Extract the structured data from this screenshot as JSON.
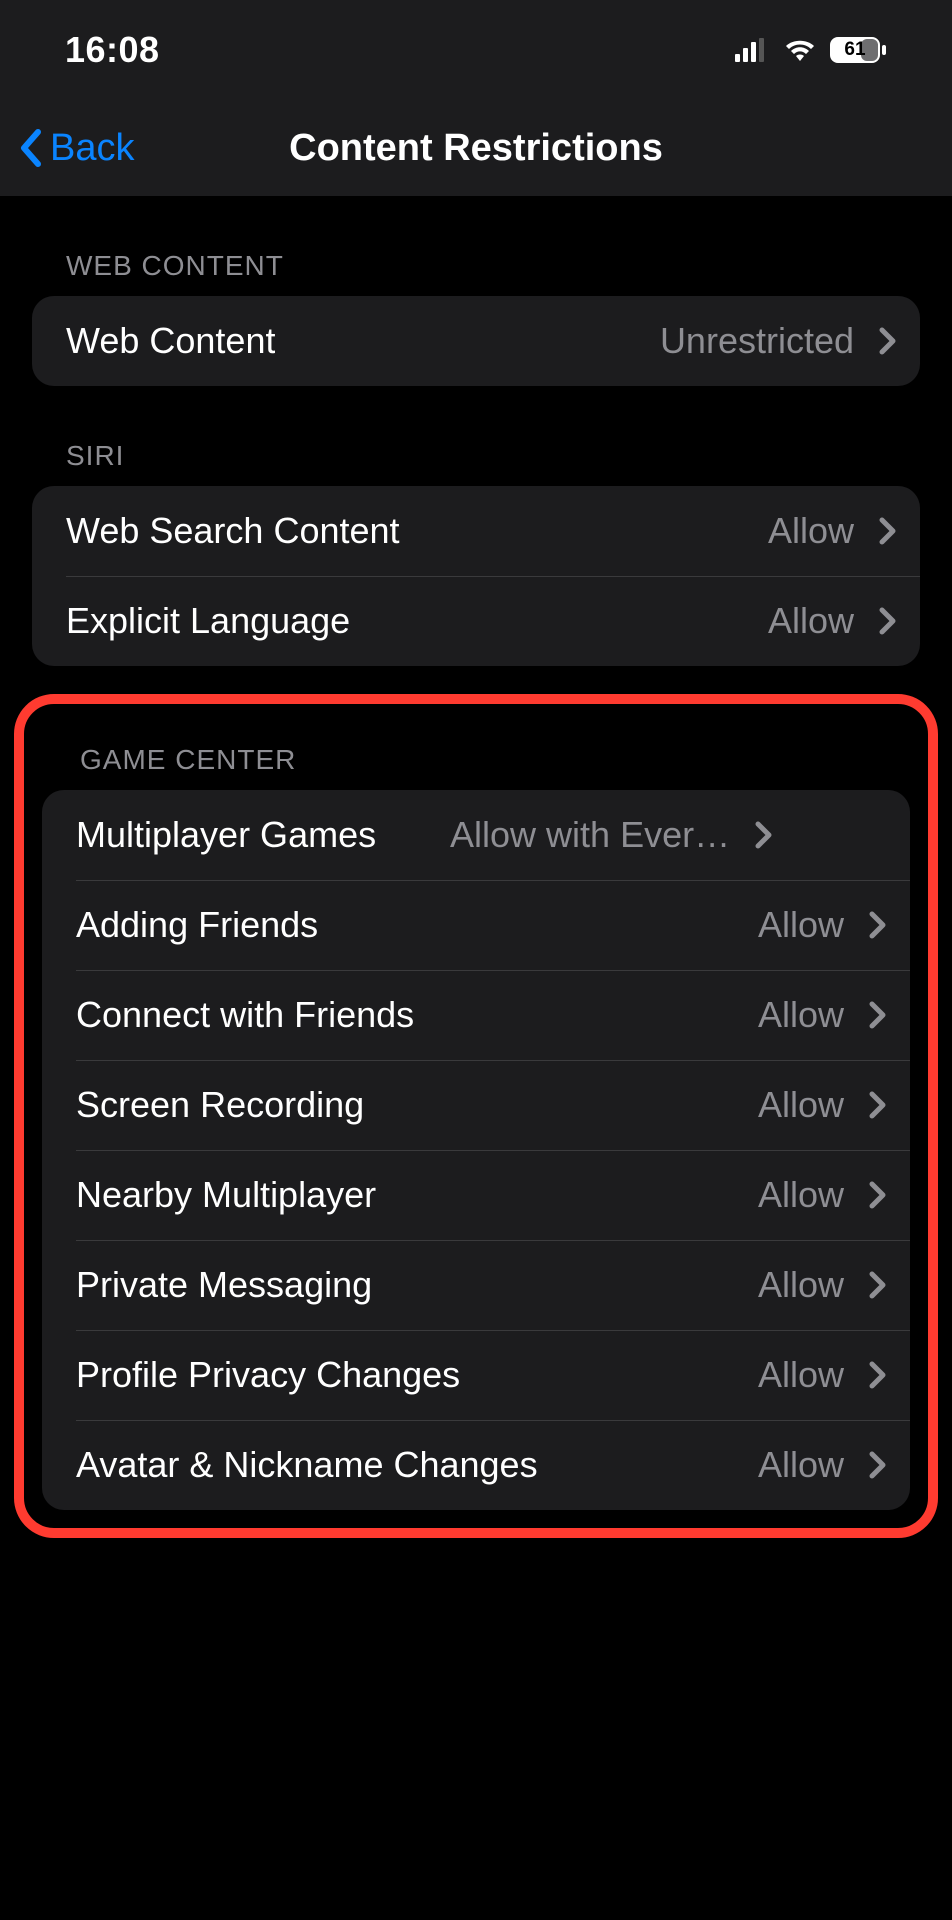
{
  "status": {
    "time": "16:08",
    "battery": "61"
  },
  "nav": {
    "back": "Back",
    "title": "Content Restrictions"
  },
  "sections": {
    "web": {
      "header": "WEB CONTENT",
      "items": [
        {
          "label": "Web Content",
          "value": "Unrestricted"
        }
      ]
    },
    "siri": {
      "header": "SIRI",
      "items": [
        {
          "label": "Web Search Content",
          "value": "Allow"
        },
        {
          "label": "Explicit Language",
          "value": "Allow"
        }
      ]
    },
    "gameCenter": {
      "header": "GAME CENTER",
      "items": [
        {
          "label": "Multiplayer Games",
          "value": "Allow with Ever…"
        },
        {
          "label": "Adding Friends",
          "value": "Allow"
        },
        {
          "label": "Connect with Friends",
          "value": "Allow"
        },
        {
          "label": "Screen Recording",
          "value": "Allow"
        },
        {
          "label": "Nearby Multiplayer",
          "value": "Allow"
        },
        {
          "label": "Private Messaging",
          "value": "Allow"
        },
        {
          "label": "Profile Privacy Changes",
          "value": "Allow"
        },
        {
          "label": "Avatar & Nickname Changes",
          "value": "Allow"
        }
      ]
    }
  }
}
